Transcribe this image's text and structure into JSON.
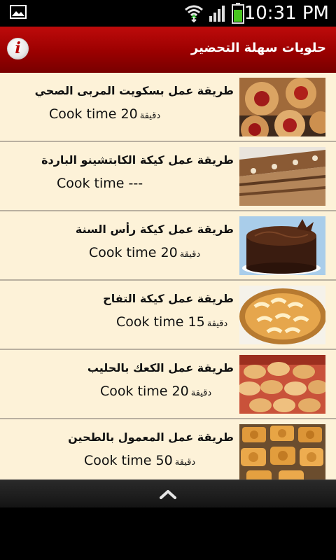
{
  "status_bar": {
    "time": "10:31 PM"
  },
  "header": {
    "title": "حلويات سهلة التحضير",
    "info_glyph": "i"
  },
  "recipes": [
    {
      "title": "طريقة عمل بسكويت المربى الصحي",
      "cook_label": "Cook time 20",
      "unit": "دقيقة",
      "image": "jam-cookies"
    },
    {
      "title": "طريقة عمل كيكة الكابتشينو الباردة",
      "cook_label": "Cook time ---",
      "unit": "",
      "image": "cappuccino-cake"
    },
    {
      "title": "طريقة عمل كيكة رأس السنة",
      "cook_label": "Cook time 20",
      "unit": "دقيقة",
      "image": "chocolate-cake"
    },
    {
      "title": "طريقة عمل كيكة التفاح",
      "cook_label": "Cook time 15",
      "unit": "دقيقة",
      "image": "apple-tart"
    },
    {
      "title": "طريقة عمل الكعك بالحليب",
      "cook_label": "Cook time 20",
      "unit": "دقيقة",
      "image": "milk-cookies"
    },
    {
      "title": "طريقة عمل المعمول بالطحين",
      "cook_label": "Cook time 50",
      "unit": "دقيقة",
      "image": "maamoul"
    }
  ],
  "colors": {
    "header_red": "#9a0000",
    "list_background": "#fdf2d8",
    "row_divider": "#b9b0a0"
  },
  "icons": {
    "gallery": "gallery-notification-icon",
    "wifi": "wifi-icon",
    "signal": "signal-icon",
    "battery": "battery-icon",
    "info": "info-icon",
    "scroll_top": "chevron-up-icon"
  }
}
